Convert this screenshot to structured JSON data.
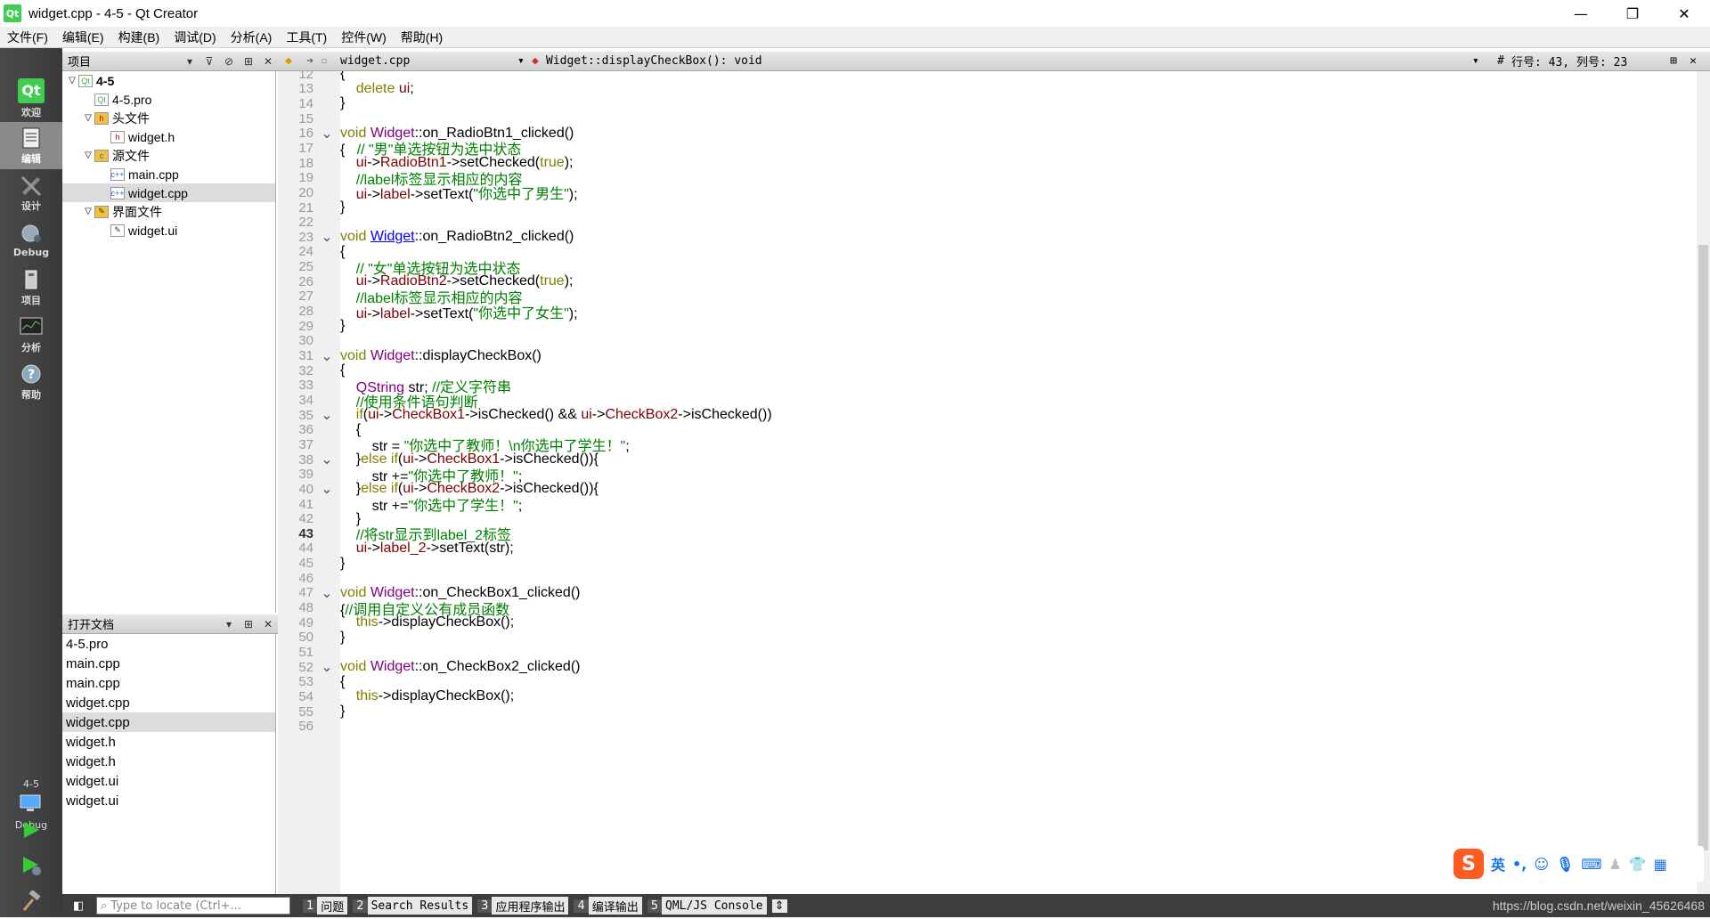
{
  "window": {
    "title": "widget.cpp - 4-5 - Qt Creator",
    "logo": "Qt",
    "controls": [
      "—",
      "❐",
      "✕"
    ]
  },
  "menu": [
    "文件(F)",
    "编辑(E)",
    "构建(B)",
    "调试(D)",
    "分析(A)",
    "工具(T)",
    "控件(W)",
    "帮助(H)"
  ],
  "modes": [
    {
      "label": "欢迎",
      "icon": "Qt"
    },
    {
      "label": "编辑",
      "icon": "edit-icon"
    },
    {
      "label": "设计",
      "icon": "design-icon"
    },
    {
      "label": "Debug",
      "icon": "debug-icon"
    },
    {
      "label": "项目",
      "icon": "project-icon"
    },
    {
      "label": "分析",
      "icon": "analyze-icon"
    },
    {
      "label": "帮助",
      "icon": "help-icon"
    }
  ],
  "kit": {
    "project": "4-5",
    "mode": "Debug"
  },
  "project_panel": {
    "title": "项目",
    "tree": [
      {
        "label": "4-5",
        "level": 0,
        "arrow": "▽",
        "bold": true,
        "icon": "pro"
      },
      {
        "label": "4-5.pro",
        "level": 1,
        "arrow": "",
        "icon": "pro"
      },
      {
        "label": "头文件",
        "level": 1,
        "arrow": "▽",
        "icon": "folder-h"
      },
      {
        "label": "widget.h",
        "level": 2,
        "arrow": "",
        "icon": "h"
      },
      {
        "label": "源文件",
        "level": 1,
        "arrow": "▽",
        "icon": "folder-cpp"
      },
      {
        "label": "main.cpp",
        "level": 2,
        "arrow": "",
        "icon": "cpp"
      },
      {
        "label": "widget.cpp",
        "level": 2,
        "arrow": "",
        "icon": "cpp",
        "selected": true
      },
      {
        "label": "界面文件",
        "level": 1,
        "arrow": "▽",
        "icon": "folder-ui"
      },
      {
        "label": "widget.ui",
        "level": 2,
        "arrow": "",
        "icon": "ui"
      }
    ]
  },
  "open_docs": {
    "title": "打开文档",
    "items": [
      {
        "label": "4-5.pro"
      },
      {
        "label": "main.cpp"
      },
      {
        "label": "main.cpp"
      },
      {
        "label": "widget.cpp"
      },
      {
        "label": "widget.cpp",
        "selected": true
      },
      {
        "label": "widget.h"
      },
      {
        "label": "widget.h"
      },
      {
        "label": "widget.ui"
      },
      {
        "label": "widget.ui"
      }
    ]
  },
  "editor_bar": {
    "file": "widget.cpp",
    "symbol": "Widget::displayCheckBox(): void",
    "hash": "#",
    "position": "行号: 43, 列号: 23"
  },
  "code": [
    {
      "n": "12",
      "f": "",
      "t": [
        [
          "",
          "{"
        ]
      ]
    },
    {
      "n": "13",
      "f": "",
      "t": [
        [
          "",
          "    "
        ],
        [
          "kw",
          "delete"
        ],
        [
          "",
          " "
        ],
        [
          "fld",
          "ui"
        ],
        [
          "",
          ";"
        ]
      ]
    },
    {
      "n": "14",
      "f": "",
      "t": [
        [
          "",
          "}"
        ]
      ]
    },
    {
      "n": "15",
      "f": "",
      "t": []
    },
    {
      "n": "16",
      "f": "v",
      "t": [
        [
          "kw",
          "void"
        ],
        [
          "",
          " "
        ],
        [
          "fn",
          "Widget"
        ],
        [
          "",
          "::on_RadioBtn1_clicked()"
        ]
      ]
    },
    {
      "n": "17",
      "f": "",
      "t": [
        [
          "",
          "{   "
        ],
        [
          "cm",
          "// \"男\"单选按钮为选中状态"
        ]
      ]
    },
    {
      "n": "18",
      "f": "",
      "t": [
        [
          "",
          "    "
        ],
        [
          "fld",
          "ui"
        ],
        [
          "",
          "->"
        ],
        [
          "fld",
          "RadioBtn1"
        ],
        [
          "",
          "->setChecked("
        ],
        [
          "kw",
          "true"
        ],
        [
          "",
          ");"
        ]
      ]
    },
    {
      "n": "19",
      "f": "",
      "t": [
        [
          "",
          "    "
        ],
        [
          "cm",
          "//label标签显示相应的内容"
        ]
      ]
    },
    {
      "n": "20",
      "f": "",
      "t": [
        [
          "",
          "    "
        ],
        [
          "fld",
          "ui"
        ],
        [
          "",
          "->"
        ],
        [
          "fld",
          "label"
        ],
        [
          "",
          "->setText("
        ],
        [
          "st",
          "\"你选中了男生\""
        ],
        [
          "",
          ");"
        ]
      ]
    },
    {
      "n": "21",
      "f": "",
      "t": [
        [
          "",
          "}"
        ]
      ]
    },
    {
      "n": "22",
      "f": "",
      "t": []
    },
    {
      "n": "23",
      "f": "v",
      "t": [
        [
          "kw",
          "void"
        ],
        [
          "",
          " "
        ],
        [
          "lnk",
          "Widget"
        ],
        [
          "",
          "::on_RadioBtn2_clicked()"
        ]
      ]
    },
    {
      "n": "24",
      "f": "",
      "t": [
        [
          "",
          "{"
        ]
      ]
    },
    {
      "n": "25",
      "f": "",
      "t": [
        [
          "",
          "    "
        ],
        [
          "cm",
          "// \"女\"单选按钮为选中状态"
        ]
      ]
    },
    {
      "n": "26",
      "f": "",
      "t": [
        [
          "",
          "    "
        ],
        [
          "fld",
          "ui"
        ],
        [
          "",
          "->"
        ],
        [
          "fld",
          "RadioBtn2"
        ],
        [
          "",
          "->setChecked("
        ],
        [
          "kw",
          "true"
        ],
        [
          "",
          ");"
        ]
      ]
    },
    {
      "n": "27",
      "f": "",
      "t": [
        [
          "",
          "    "
        ],
        [
          "cm",
          "//label标签显示相应的内容"
        ]
      ]
    },
    {
      "n": "28",
      "f": "",
      "t": [
        [
          "",
          "    "
        ],
        [
          "fld",
          "ui"
        ],
        [
          "",
          "->"
        ],
        [
          "fld",
          "label"
        ],
        [
          "",
          "->setText("
        ],
        [
          "st",
          "\"你选中了女生\""
        ],
        [
          "",
          ");"
        ]
      ]
    },
    {
      "n": "29",
      "f": "",
      "t": [
        [
          "",
          "}"
        ]
      ]
    },
    {
      "n": "30",
      "f": "",
      "t": []
    },
    {
      "n": "31",
      "f": "v",
      "t": [
        [
          "kw",
          "void"
        ],
        [
          "",
          " "
        ],
        [
          "fn",
          "Widget"
        ],
        [
          "",
          "::displayCheckBox()"
        ]
      ]
    },
    {
      "n": "32",
      "f": "",
      "t": [
        [
          "",
          "{"
        ]
      ]
    },
    {
      "n": "33",
      "f": "",
      "t": [
        [
          "",
          "    "
        ],
        [
          "fn",
          "QString"
        ],
        [
          "",
          " str; "
        ],
        [
          "cm",
          "//定义字符串"
        ]
      ]
    },
    {
      "n": "34",
      "f": "",
      "t": [
        [
          "",
          "    "
        ],
        [
          "cm",
          "//使用条件语句判断"
        ]
      ]
    },
    {
      "n": "35",
      "f": "v",
      "t": [
        [
          "",
          "    "
        ],
        [
          "kw",
          "if"
        ],
        [
          "",
          "("
        ],
        [
          "fld",
          "ui"
        ],
        [
          "",
          "->"
        ],
        [
          "fld",
          "CheckBox1"
        ],
        [
          "",
          "->isChecked() && "
        ],
        [
          "fld",
          "ui"
        ],
        [
          "",
          "->"
        ],
        [
          "fld",
          "CheckBox2"
        ],
        [
          "",
          "->isChecked())"
        ]
      ]
    },
    {
      "n": "36",
      "f": "",
      "t": [
        [
          "",
          "    {"
        ]
      ]
    },
    {
      "n": "37",
      "f": "",
      "t": [
        [
          "",
          "        str = "
        ],
        [
          "st",
          "\"你选中了教师！\\n你选中了学生！\""
        ],
        [
          "",
          ";"
        ]
      ]
    },
    {
      "n": "38",
      "f": "v",
      "t": [
        [
          "",
          "    }"
        ],
        [
          "kw",
          "else if"
        ],
        [
          "",
          "("
        ],
        [
          "fld",
          "ui"
        ],
        [
          "",
          "->"
        ],
        [
          "fld",
          "CheckBox1"
        ],
        [
          "",
          "->isChecked()){"
        ]
      ]
    },
    {
      "n": "39",
      "f": "",
      "t": [
        [
          "",
          "        str +="
        ],
        [
          "st",
          "\"你选中了教师！\""
        ],
        [
          "",
          ";"
        ]
      ]
    },
    {
      "n": "40",
      "f": "v",
      "t": [
        [
          "",
          "    }"
        ],
        [
          "kw",
          "else if"
        ],
        [
          "",
          "("
        ],
        [
          "fld",
          "ui"
        ],
        [
          "",
          "->"
        ],
        [
          "fld",
          "CheckBox2"
        ],
        [
          "",
          "->isChecked()){"
        ]
      ]
    },
    {
      "n": "41",
      "f": "",
      "t": [
        [
          "",
          "        str +="
        ],
        [
          "st",
          "\"你选中了学生！\""
        ],
        [
          "",
          ";"
        ]
      ]
    },
    {
      "n": "42",
      "f": "",
      "t": [
        [
          "",
          "    }"
        ]
      ]
    },
    {
      "n": "43",
      "f": "",
      "t": [
        [
          "",
          "    "
        ],
        [
          "cm",
          "//将str显示到label_2标签"
        ]
      ],
      "current": true
    },
    {
      "n": "44",
      "f": "",
      "t": [
        [
          "",
          "    "
        ],
        [
          "fld",
          "ui"
        ],
        [
          "",
          "->"
        ],
        [
          "fld",
          "label_2"
        ],
        [
          "",
          "->setText(str);"
        ]
      ]
    },
    {
      "n": "45",
      "f": "",
      "t": [
        [
          "",
          "}"
        ]
      ]
    },
    {
      "n": "46",
      "f": "",
      "t": []
    },
    {
      "n": "47",
      "f": "v",
      "t": [
        [
          "kw",
          "void"
        ],
        [
          "",
          " "
        ],
        [
          "fn",
          "Widget"
        ],
        [
          "",
          "::on_CheckBox1_clicked()"
        ]
      ]
    },
    {
      "n": "48",
      "f": "",
      "t": [
        [
          "",
          "{"
        ],
        [
          "cm",
          "//调用自定义公有成员函数"
        ]
      ]
    },
    {
      "n": "49",
      "f": "",
      "t": [
        [
          "",
          "    "
        ],
        [
          "kw",
          "this"
        ],
        [
          "",
          "->displayCheckBox();"
        ]
      ]
    },
    {
      "n": "50",
      "f": "",
      "t": [
        [
          "",
          "}"
        ]
      ]
    },
    {
      "n": "51",
      "f": "",
      "t": []
    },
    {
      "n": "52",
      "f": "v",
      "t": [
        [
          "kw",
          "void"
        ],
        [
          "",
          " "
        ],
        [
          "fn",
          "Widget"
        ],
        [
          "",
          "::on_CheckBox2_clicked()"
        ]
      ]
    },
    {
      "n": "53",
      "f": "",
      "t": [
        [
          "",
          "{"
        ]
      ]
    },
    {
      "n": "54",
      "f": "",
      "t": [
        [
          "",
          "    "
        ],
        [
          "kw",
          "this"
        ],
        [
          "",
          "->displayCheckBox();"
        ]
      ]
    },
    {
      "n": "55",
      "f": "",
      "t": [
        [
          "",
          "}"
        ]
      ]
    },
    {
      "n": "56",
      "f": "",
      "t": []
    }
  ],
  "status": {
    "locate_placeholder": "Type to locate (Ctrl+...",
    "tabs": [
      {
        "num": "1",
        "label": "问题"
      },
      {
        "num": "2",
        "label": "Search Results"
      },
      {
        "num": "3",
        "label": "应用程序输出"
      },
      {
        "num": "4",
        "label": "编译输出"
      },
      {
        "num": "5",
        "label": "QML/JS Console"
      }
    ],
    "url": "https://blog.csdn.net/weixin_45626468"
  },
  "ime": {
    "logo": "S",
    "lang": "英"
  },
  "colors": {
    "keyword": "#808000",
    "function": "#800080",
    "member": "#800000",
    "comment": "#008000",
    "link": "#0000ff"
  }
}
